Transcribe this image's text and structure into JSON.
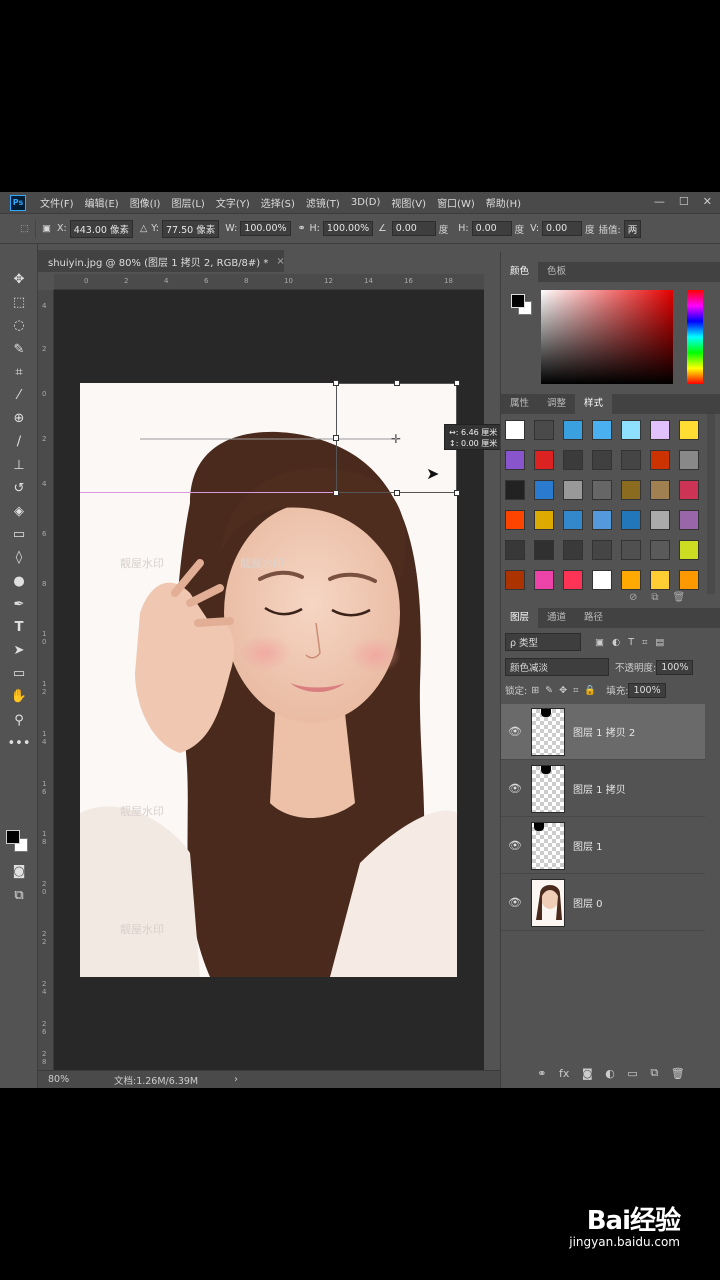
{
  "menubar": {
    "logo": "Ps",
    "items": [
      "文件(F)",
      "编辑(E)",
      "图像(I)",
      "图层(L)",
      "文字(Y)",
      "选择(S)",
      "滤镜(T)",
      "3D(D)",
      "视图(V)",
      "窗口(W)",
      "帮助(H)"
    ]
  },
  "optbar": {
    "x_label": "X:",
    "x_value": "443.00 像素",
    "y_label": "Y:",
    "y_value": "77.50 像素",
    "w_label": "W:",
    "w_value": "100.00%",
    "h_label": "H:",
    "h_value": "100.00%",
    "angle_value": "0.00",
    "angle_unit": "度",
    "hskew_label": "H:",
    "hskew_value": "0.00",
    "hskew_unit": "度",
    "vskew_label": "V:",
    "vskew_value": "0.00",
    "vskew_unit": "度",
    "interp_label": "插值:",
    "interp_value": "两"
  },
  "document": {
    "tab_title": "shuiyin.jpg @ 80% (图层 1 拷贝 2, RGB/8#) *",
    "tooltip_x": "↔: 6.46 厘米",
    "tooltip_y": "↕: 0.00 厘米",
    "watermark_text": "靓屋水印",
    "ruler_h": [
      "0",
      "2",
      "4",
      "6",
      "8",
      "10",
      "12",
      "14",
      "16",
      "18"
    ],
    "ruler_v": [
      "4",
      "2",
      "0",
      "2",
      "4",
      "6",
      "8",
      "1 0",
      "1 2",
      "1 4",
      "1 6",
      "1 8",
      "2 0",
      "2 2",
      "2 4",
      "2 6",
      "2 8",
      "3 0"
    ]
  },
  "status": {
    "zoom": "80%",
    "doc_size": "文档:1.26M/6.39M",
    "arrow": "›"
  },
  "color_panel": {
    "tabs": [
      "颜色",
      "色板"
    ]
  },
  "styles_panel": {
    "tabs": [
      "属性",
      "调整",
      "样式"
    ],
    "swatch_colors": [
      "#ffffff",
      "#4a4a4a",
      "#3aa0e0",
      "#4ab0f0",
      "#8fe0ff",
      "#e0c0ff",
      "#ffdd33",
      "#8855cc",
      "#dd2222",
      "#3b3b3b",
      "#404040",
      "#454545",
      "#cc3300",
      "#888888",
      "#222222",
      "#2a7ad0",
      "#999999",
      "#666666",
      "#8b6b20",
      "#a08050",
      "#cc3355",
      "#ff4400",
      "#ddaa00",
      "#3388cc",
      "#5599dd",
      "#2277bb",
      "#aaaaaa",
      "#9966aa",
      "#383838",
      "#303030",
      "#3a3a3a",
      "#454545",
      "#505050",
      "#5a5a5a",
      "#ccdd22",
      "#aa3300",
      "#ee44aa",
      "#ff3355",
      "#ffffff",
      "#ffaa00",
      "#ffcc33",
      "#ff9900"
    ]
  },
  "layers_panel": {
    "tabs": [
      "图层",
      "通道",
      "路径"
    ],
    "filter_label": "ρ 类型",
    "blend_mode": "颜色减淡",
    "opacity_label": "不透明度:",
    "opacity_value": "100%",
    "lock_label": "锁定:",
    "fill_label": "填充:",
    "fill_value": "100%",
    "layers": [
      {
        "name": "图层 1 拷贝 2"
      },
      {
        "name": "图层 1 拷贝"
      },
      {
        "name": "图层 1"
      },
      {
        "name": "图层 0"
      }
    ],
    "footer_fx": "fx"
  },
  "baidu": {
    "brand": "Bai经验",
    "url": "jingyan.baidu.com"
  }
}
